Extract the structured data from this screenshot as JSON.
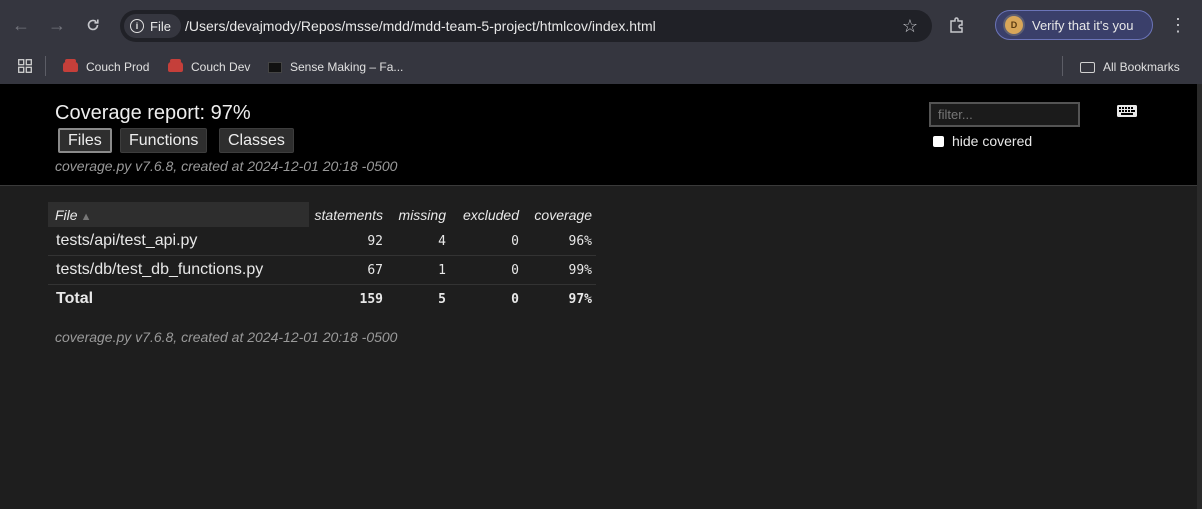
{
  "browser": {
    "chip_label": "File",
    "url": "/Users/devajmody/Repos/msse/mdd/mdd-team-5-project/htmlcov/index.html",
    "profile_button": "Verify that it's you",
    "avatar_letter": "D"
  },
  "bookmarks": {
    "items": [
      {
        "label": "Couch Prod",
        "icon": "couch-icon"
      },
      {
        "label": "Couch Dev",
        "icon": "couch-icon"
      },
      {
        "label": "Sense Making – Fa...",
        "icon": "sense-making-icon"
      }
    ],
    "all_label": "All Bookmarks"
  },
  "report": {
    "title": "Coverage report: 97%",
    "tabs": [
      "Files",
      "Functions",
      "Classes"
    ],
    "created_text": "coverage.py v7.6.8, created at 2024-12-01 20:18 -0500",
    "filter_placeholder": "filter...",
    "hide_covered_label": "hide covered"
  },
  "table": {
    "headers": [
      "File",
      "statements",
      "missing",
      "excluded",
      "coverage"
    ],
    "rows": [
      {
        "file": "tests/api/test_api.py",
        "statements": "92",
        "missing": "4",
        "excluded": "0",
        "coverage": "96%"
      },
      {
        "file": "tests/db/test_db_functions.py",
        "statements": "67",
        "missing": "1",
        "excluded": "0",
        "coverage": "99%"
      }
    ],
    "total": {
      "file": "Total",
      "statements": "159",
      "missing": "5",
      "excluded": "0",
      "coverage": "97%"
    }
  },
  "colors": {
    "header_bg": "#000000",
    "page_bg": "#1e1e1e",
    "chrome_bg": "#35363f",
    "verify_bg": "#3a3f6a"
  }
}
